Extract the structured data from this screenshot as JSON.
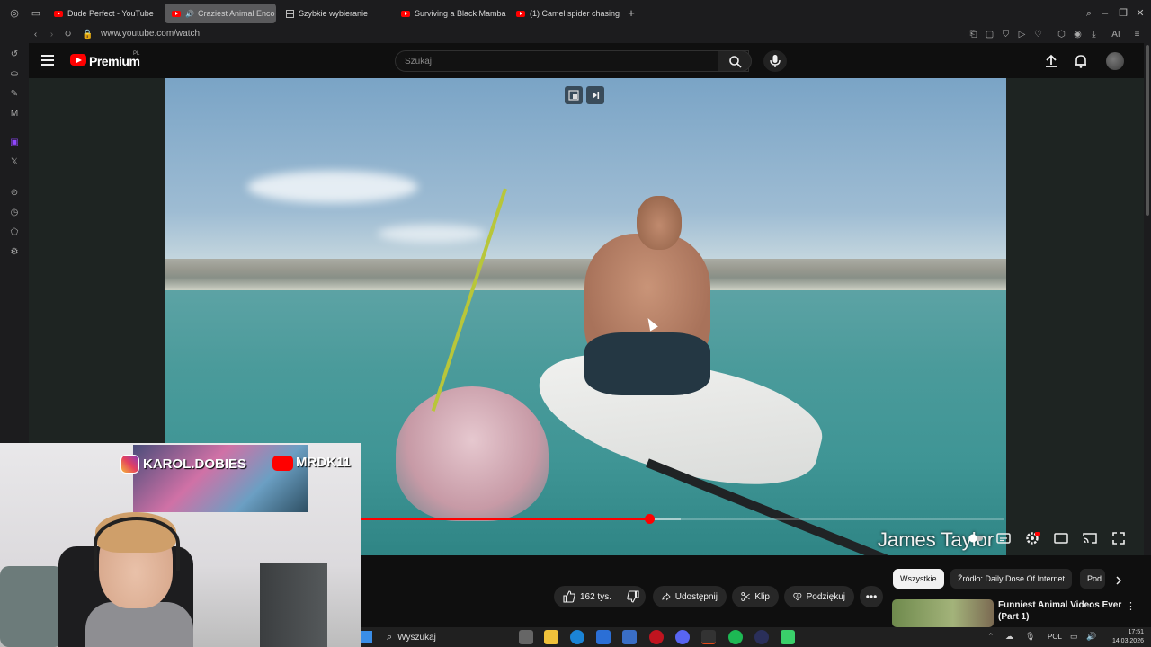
{
  "browser": {
    "tabs": [
      {
        "label": "Dude Perfect - YouTube",
        "active": false
      },
      {
        "label": "Craziest Animal Enco",
        "active": true
      },
      {
        "label": "Szybkie wybieranie",
        "active": false
      },
      {
        "label": "Surviving a Black Mamba",
        "active": false
      },
      {
        "label": "(1) Camel spider chasing",
        "active": false
      }
    ],
    "url": "www.youtube.com/watch",
    "ai_label": "AI"
  },
  "youtube": {
    "brand": "Premium",
    "country": "PL",
    "search_placeholder": "Szukaj"
  },
  "player": {
    "caption_name": "James Taylor",
    "progress_fraction": 0.449,
    "loaded_fraction": 0.497
  },
  "actions": {
    "likes": "162 tys.",
    "share": "Udostępnij",
    "clip": "Klip",
    "thanks": "Podziękuj"
  },
  "chips": [
    "Wszystkie",
    "Źródło: Daily Dose Of Internet",
    "Pod"
  ],
  "recommendation": {
    "title": "Funniest Animal Videos Ever (Part 1)"
  },
  "webcam": {
    "instagram_handle": "KAROL.DOBIES",
    "youtube_channel": "MRDK11"
  },
  "taskbar": {
    "search_label": "Wyszukaj",
    "language": "POL",
    "time": "17:51",
    "date": "14.03.2026"
  },
  "colors": {
    "accent": "#ff0000",
    "background": "#0f0f0f"
  }
}
